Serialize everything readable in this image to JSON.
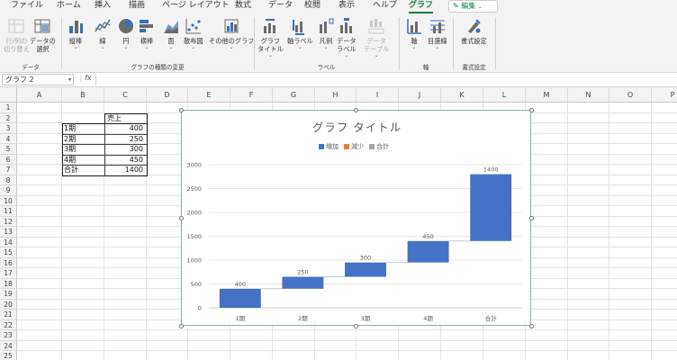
{
  "tabs": [
    {
      "label": "ファイル",
      "active": false
    },
    {
      "label": "ホーム",
      "active": false
    },
    {
      "label": "挿入",
      "active": false
    },
    {
      "label": "描画",
      "active": false
    },
    {
      "label": "ページ レイアウト",
      "active": false
    },
    {
      "label": "数式",
      "active": false
    },
    {
      "label": "データ",
      "active": false
    },
    {
      "label": "校閲",
      "active": false
    },
    {
      "label": "表示",
      "active": false
    },
    {
      "label": "ヘルプ",
      "active": false
    },
    {
      "label": "グラフ",
      "active": true
    }
  ],
  "edit_mode": {
    "label": "編集",
    "icon": "pencil-icon"
  },
  "ribbon": {
    "buttons": [
      {
        "label": "行/列の\n切り替え",
        "icon": "switch-row-col-icon",
        "disabled": true
      },
      {
        "label": "データの\n選択",
        "icon": "select-data-icon",
        "disabled": false
      },
      {
        "label": "縦棒",
        "icon": "column-chart-icon",
        "disabled": false,
        "dropdown": true
      },
      {
        "label": "線",
        "icon": "line-chart-icon",
        "disabled": false,
        "dropdown": true
      },
      {
        "label": "円",
        "icon": "pie-chart-icon",
        "disabled": false,
        "dropdown": true
      },
      {
        "label": "横棒",
        "icon": "bar-chart-icon",
        "disabled": false,
        "dropdown": true
      },
      {
        "label": "面",
        "icon": "area-chart-icon",
        "disabled": false,
        "dropdown": true
      },
      {
        "label": "散布図",
        "icon": "scatter-chart-icon",
        "disabled": false,
        "dropdown": true
      },
      {
        "label": "その他のグラフ",
        "icon": "other-charts-icon",
        "disabled": false,
        "dropdown": true
      },
      {
        "label": "グラフ\nタイトル",
        "icon": "chart-title-icon",
        "disabled": false,
        "dropdown": true
      },
      {
        "label": "軸ラベル",
        "icon": "axis-label-icon",
        "disabled": false,
        "dropdown": true
      },
      {
        "label": "凡例",
        "icon": "legend-icon",
        "disabled": false,
        "dropdown": true
      },
      {
        "label": "データ\nラベル",
        "icon": "data-label-icon",
        "disabled": false,
        "dropdown": true
      },
      {
        "label": "データ\nテーブル",
        "icon": "data-table-icon",
        "disabled": true,
        "dropdown": true
      },
      {
        "label": "軸",
        "icon": "axes-icon",
        "disabled": false,
        "dropdown": true
      },
      {
        "label": "目盛線",
        "icon": "gridlines-icon",
        "disabled": false,
        "dropdown": true
      },
      {
        "label": "書式設定",
        "icon": "format-icon",
        "disabled": false
      }
    ],
    "groups": [
      "データ",
      "グラフの種類の変更",
      "ラベル",
      "軸",
      "書式設定"
    ]
  },
  "formula_bar": {
    "name_box": "グラフ 2",
    "fx": "fx",
    "value": ""
  },
  "columns": [
    "A",
    "B",
    "C",
    "D",
    "E",
    "F",
    "G",
    "H",
    "I",
    "J",
    "K",
    "L",
    "M",
    "N",
    "O",
    "P"
  ],
  "rows": [
    "1",
    "2",
    "3",
    "4",
    "5",
    "6",
    "7",
    "8",
    "9",
    "10",
    "11",
    "12",
    "13",
    "14",
    "15",
    "16",
    "17",
    "18",
    "19",
    "20",
    "21",
    "22",
    "23",
    "24",
    "25"
  ],
  "table": {
    "header": "売上",
    "rows": [
      {
        "label": "1期",
        "value": "400"
      },
      {
        "label": "2期",
        "value": "250"
      },
      {
        "label": "3期",
        "value": "300"
      },
      {
        "label": "4期",
        "value": "450"
      },
      {
        "label": "合計",
        "value": "1400"
      }
    ]
  },
  "chart_data": {
    "type": "waterfall",
    "title": "グラフ タイトル",
    "legend": [
      {
        "name": "増加",
        "color": "#4472c4"
      },
      {
        "name": "減少",
        "color": "#ed7d31"
      },
      {
        "name": "合計",
        "color": "#a5a5a5"
      }
    ],
    "legend_position": "top",
    "categories": [
      "1期",
      "2期",
      "3期",
      "4期",
      "合計"
    ],
    "values": [
      400,
      250,
      300,
      450,
      1400
    ],
    "bars": [
      {
        "category": "1期",
        "start": 0,
        "end": 400,
        "label": "400"
      },
      {
        "category": "2期",
        "start": 400,
        "end": 650,
        "label": "250"
      },
      {
        "category": "3期",
        "start": 650,
        "end": 950,
        "label": "300"
      },
      {
        "category": "4期",
        "start": 950,
        "end": 1400,
        "label": "450"
      },
      {
        "category": "合計",
        "start": 1400,
        "end": 2800,
        "label": "1400"
      }
    ],
    "bar_color": "#4472c4",
    "ylim": [
      0,
      3000
    ],
    "yticks": [
      "0",
      "500",
      "1000",
      "1500",
      "2000",
      "2500",
      "3000"
    ],
    "grid": true
  }
}
